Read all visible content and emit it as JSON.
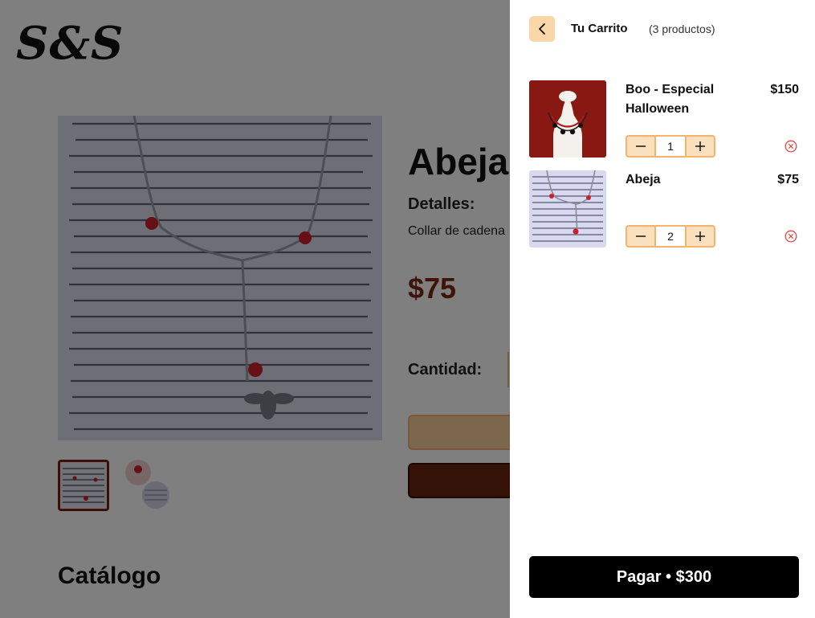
{
  "brand": {
    "logo": "S&S"
  },
  "product": {
    "title": "Abeja",
    "details_label": "Detalles:",
    "details_text": "Collar de cadena",
    "price": "$75",
    "quantity_label": "Cantidad:",
    "thumbnails": [
      "bee-necklace-photo",
      "beads-photo"
    ]
  },
  "catalog": {
    "title": "Catálogo"
  },
  "cart": {
    "title": "Tu Carrito",
    "count_text": "(3 productos)",
    "items": [
      {
        "name": "Boo - Especial Halloween",
        "price": "$150",
        "quantity": "1",
        "image": "halloween-necklace-photo"
      },
      {
        "name": "Abeja",
        "price": "$75",
        "quantity": "2",
        "image": "bee-necklace-photo"
      }
    ],
    "checkout_label": "Pagar • $300"
  },
  "icons": {
    "back": "chevron-left-icon",
    "decrement": "minus-icon",
    "increment": "plus-icon",
    "remove": "close-circle-icon"
  },
  "colors": {
    "accent": "#fad7a8",
    "accent_border": "#f3b56c",
    "price_brown": "#7a2a10",
    "remove_red": "#e04848",
    "checkout_bg": "#000000"
  }
}
